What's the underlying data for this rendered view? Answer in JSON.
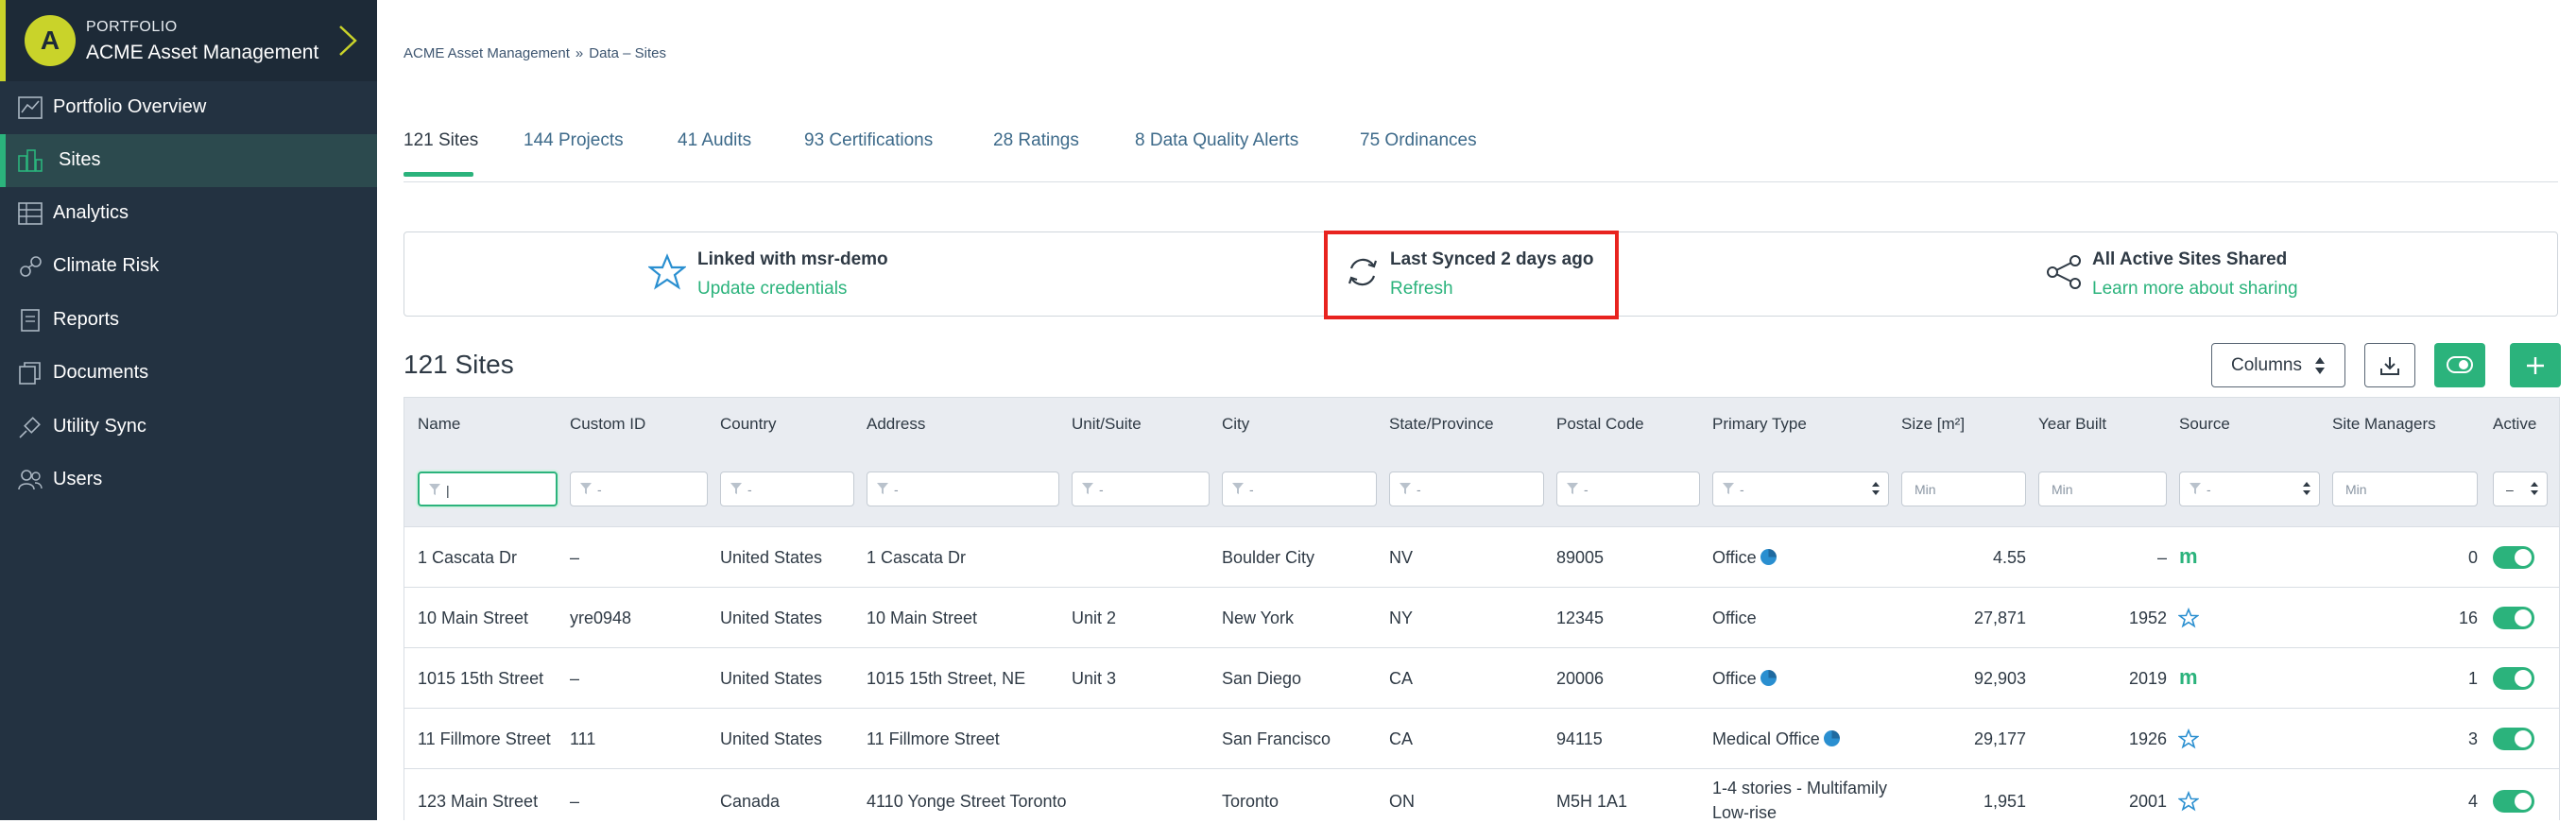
{
  "sidebar": {
    "portfolio_caption": "PORTFOLIO",
    "portfolio_name": "ACME Asset Management",
    "avatar_letter": "A",
    "items": [
      {
        "label": "Portfolio Overview",
        "icon": "chart-icon"
      },
      {
        "label": "Sites",
        "icon": "buildings-icon",
        "active": true
      },
      {
        "label": "Analytics",
        "icon": "analytics-icon"
      },
      {
        "label": "Climate Risk",
        "icon": "climate-icon"
      },
      {
        "label": "Reports",
        "icon": "report-icon"
      },
      {
        "label": "Documents",
        "icon": "documents-icon"
      },
      {
        "label": "Utility Sync",
        "icon": "plug-icon"
      },
      {
        "label": "Users",
        "icon": "users-icon"
      }
    ]
  },
  "breadcrumb": {
    "root": "ACME Asset Management",
    "separator": "»",
    "current": "Data – Sites"
  },
  "tabs": [
    "121 Sites",
    "144 Projects",
    "41 Audits",
    "93 Certifications",
    "28 Ratings",
    "8 Data Quality Alerts",
    "75 Ordinances"
  ],
  "sync": {
    "linked_title": "Linked with msr-demo",
    "linked_link": "Update credentials",
    "synced_title": "Last Synced 2 days ago",
    "synced_link": "Refresh",
    "shared_title": "All Active Sites Shared",
    "shared_link": "Learn more about sharing"
  },
  "sites_title": "121 Sites",
  "toolbar": {
    "columns_label": "Columns"
  },
  "table": {
    "headers": [
      "Name",
      "Custom ID",
      "Country",
      "Address",
      "Unit/Suite",
      "City",
      "State/Province",
      "Postal Code",
      "Primary Type",
      "Size [m²]",
      "Year Built",
      "Source",
      "Site Managers",
      "Active"
    ],
    "filters": {
      "dash": "-",
      "min": "Min",
      "active_select": "–"
    },
    "rows": [
      {
        "name": "1 Cascata Dr",
        "custom_id": "–",
        "country": "United States",
        "address": "1 Cascata Dr",
        "unit": "",
        "city": "Boulder City",
        "state": "NV",
        "postal": "89005",
        "type": "Office",
        "size": "4.55",
        "year": "–",
        "source": "m",
        "managers": "0"
      },
      {
        "name": "10 Main Street",
        "custom_id": "yre0948",
        "country": "United States",
        "address": "10 Main Street",
        "unit": "Unit 2",
        "city": "New York",
        "state": "NY",
        "postal": "12345",
        "type": "Office",
        "size": "27,871",
        "year": "1952",
        "source": "star",
        "managers": "16"
      },
      {
        "name": "1015 15th Street",
        "custom_id": "–",
        "country": "United States",
        "address": "1015 15th Street, NE",
        "unit": "Unit 3",
        "city": "San Diego",
        "state": "CA",
        "postal": "20006",
        "type": "Office",
        "size": "92,903",
        "year": "2019",
        "source": "m",
        "managers": "1"
      },
      {
        "name": "11 Fillmore Street",
        "custom_id": "111",
        "country": "United States",
        "address": "11 Fillmore Street",
        "unit": "",
        "city": "San Francisco",
        "state": "CA",
        "postal": "94115",
        "type": "Medical Office",
        "size": "29,177",
        "year": "1926",
        "source": "star",
        "managers": "3"
      },
      {
        "name": "123 Main Street",
        "custom_id": "–",
        "country": "Canada",
        "address": "4110 Yonge Street Toronto",
        "unit": "",
        "city": "Toronto",
        "state": "ON",
        "postal": "M5H 1A1",
        "type_line1": "1-4 stories - Multifamily",
        "type_line2": "Low-rise",
        "size": "1,951",
        "year": "2001",
        "source": "star",
        "managers": "4"
      }
    ]
  },
  "colors": {
    "accent": "#2bb37c",
    "sidebar": "#233241",
    "highlight": "#e8231f",
    "brand": "#c9d32a"
  }
}
